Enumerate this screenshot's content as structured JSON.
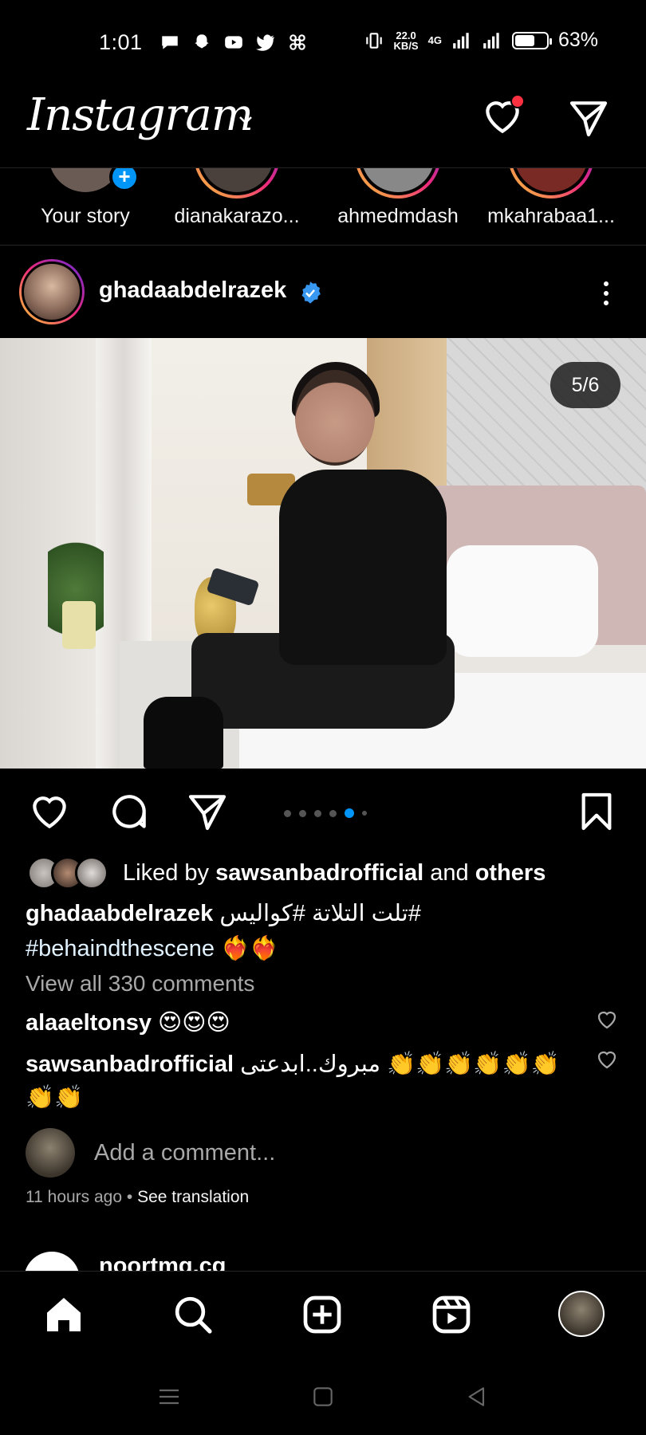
{
  "status_bar": {
    "time": "1:01",
    "network_speed_value": "22.0",
    "network_speed_unit": "KB/S",
    "network_type": "4G",
    "battery": "63%",
    "battery_level": 0.63
  },
  "header": {
    "logo": "Instagram",
    "has_notification_dot": true
  },
  "stories": [
    {
      "name": "Your story",
      "own": true
    },
    {
      "name": "dianakarazo..."
    },
    {
      "name": "ahmedmdash"
    },
    {
      "name": "mkahrabaa1..."
    }
  ],
  "post": {
    "username": "ghadaabdelrazek",
    "verified": true,
    "image_counter": "5/6",
    "carousel": {
      "total": 6,
      "current": 5
    },
    "liked_by": {
      "prefix": "Liked by",
      "user": "sawsanbadrofficial",
      "middle": "and",
      "others": "others"
    },
    "caption": {
      "user": "ghadaabdelrazek",
      "text": "#تلت التلاتة #كواليس",
      "hashtag_line": "#behaindthescene",
      "emoji": "❤️‍🔥❤️‍🔥"
    },
    "view_all_comments": "View all 330 comments",
    "comments": [
      {
        "user": "alaaeltonsy",
        "text": "😍😍😍"
      },
      {
        "user": "sawsanbadrofficial",
        "text": "مبروك..ابدعتى 👏👏👏👏👏👏👏👏"
      }
    ],
    "add_comment_placeholder": "Add a comment...",
    "time_ago": "11 hours ago",
    "separator": "•",
    "see_translation": "See translation"
  },
  "next_post": {
    "username": "noortmg.cg"
  },
  "colors": {
    "accent_blue": "#0095f6",
    "notification_red": "#ff3040",
    "muted_text": "#a8a8a8"
  },
  "icons": {
    "header": [
      "heart-icon",
      "send-icon"
    ],
    "actions": [
      "like-icon",
      "comment-icon",
      "share-icon",
      "bookmark-icon"
    ],
    "bottom_nav": [
      "home-icon",
      "search-icon",
      "create-icon",
      "reels-icon",
      "profile-avatar"
    ],
    "system_nav": [
      "menu-icon",
      "home-square-icon",
      "back-icon"
    ]
  }
}
